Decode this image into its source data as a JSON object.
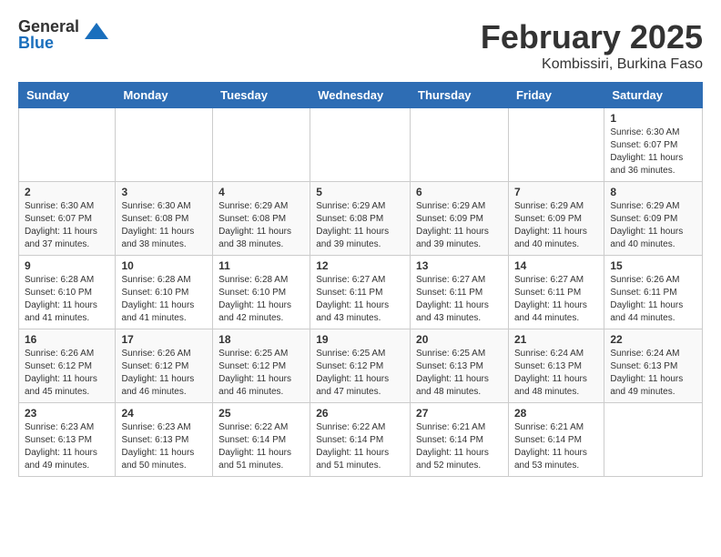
{
  "header": {
    "logo_general": "General",
    "logo_blue": "Blue",
    "month_title": "February 2025",
    "location": "Kombissiri, Burkina Faso"
  },
  "days_of_week": [
    "Sunday",
    "Monday",
    "Tuesday",
    "Wednesday",
    "Thursday",
    "Friday",
    "Saturday"
  ],
  "weeks": [
    [
      {
        "day": "",
        "info": ""
      },
      {
        "day": "",
        "info": ""
      },
      {
        "day": "",
        "info": ""
      },
      {
        "day": "",
        "info": ""
      },
      {
        "day": "",
        "info": ""
      },
      {
        "day": "",
        "info": ""
      },
      {
        "day": "1",
        "info": "Sunrise: 6:30 AM\nSunset: 6:07 PM\nDaylight: 11 hours and 36 minutes."
      }
    ],
    [
      {
        "day": "2",
        "info": "Sunrise: 6:30 AM\nSunset: 6:07 PM\nDaylight: 11 hours and 37 minutes."
      },
      {
        "day": "3",
        "info": "Sunrise: 6:30 AM\nSunset: 6:08 PM\nDaylight: 11 hours and 38 minutes."
      },
      {
        "day": "4",
        "info": "Sunrise: 6:29 AM\nSunset: 6:08 PM\nDaylight: 11 hours and 38 minutes."
      },
      {
        "day": "5",
        "info": "Sunrise: 6:29 AM\nSunset: 6:08 PM\nDaylight: 11 hours and 39 minutes."
      },
      {
        "day": "6",
        "info": "Sunrise: 6:29 AM\nSunset: 6:09 PM\nDaylight: 11 hours and 39 minutes."
      },
      {
        "day": "7",
        "info": "Sunrise: 6:29 AM\nSunset: 6:09 PM\nDaylight: 11 hours and 40 minutes."
      },
      {
        "day": "8",
        "info": "Sunrise: 6:29 AM\nSunset: 6:09 PM\nDaylight: 11 hours and 40 minutes."
      }
    ],
    [
      {
        "day": "9",
        "info": "Sunrise: 6:28 AM\nSunset: 6:10 PM\nDaylight: 11 hours and 41 minutes."
      },
      {
        "day": "10",
        "info": "Sunrise: 6:28 AM\nSunset: 6:10 PM\nDaylight: 11 hours and 41 minutes."
      },
      {
        "day": "11",
        "info": "Sunrise: 6:28 AM\nSunset: 6:10 PM\nDaylight: 11 hours and 42 minutes."
      },
      {
        "day": "12",
        "info": "Sunrise: 6:27 AM\nSunset: 6:11 PM\nDaylight: 11 hours and 43 minutes."
      },
      {
        "day": "13",
        "info": "Sunrise: 6:27 AM\nSunset: 6:11 PM\nDaylight: 11 hours and 43 minutes."
      },
      {
        "day": "14",
        "info": "Sunrise: 6:27 AM\nSunset: 6:11 PM\nDaylight: 11 hours and 44 minutes."
      },
      {
        "day": "15",
        "info": "Sunrise: 6:26 AM\nSunset: 6:11 PM\nDaylight: 11 hours and 44 minutes."
      }
    ],
    [
      {
        "day": "16",
        "info": "Sunrise: 6:26 AM\nSunset: 6:12 PM\nDaylight: 11 hours and 45 minutes."
      },
      {
        "day": "17",
        "info": "Sunrise: 6:26 AM\nSunset: 6:12 PM\nDaylight: 11 hours and 46 minutes."
      },
      {
        "day": "18",
        "info": "Sunrise: 6:25 AM\nSunset: 6:12 PM\nDaylight: 11 hours and 46 minutes."
      },
      {
        "day": "19",
        "info": "Sunrise: 6:25 AM\nSunset: 6:12 PM\nDaylight: 11 hours and 47 minutes."
      },
      {
        "day": "20",
        "info": "Sunrise: 6:25 AM\nSunset: 6:13 PM\nDaylight: 11 hours and 48 minutes."
      },
      {
        "day": "21",
        "info": "Sunrise: 6:24 AM\nSunset: 6:13 PM\nDaylight: 11 hours and 48 minutes."
      },
      {
        "day": "22",
        "info": "Sunrise: 6:24 AM\nSunset: 6:13 PM\nDaylight: 11 hours and 49 minutes."
      }
    ],
    [
      {
        "day": "23",
        "info": "Sunrise: 6:23 AM\nSunset: 6:13 PM\nDaylight: 11 hours and 49 minutes."
      },
      {
        "day": "24",
        "info": "Sunrise: 6:23 AM\nSunset: 6:13 PM\nDaylight: 11 hours and 50 minutes."
      },
      {
        "day": "25",
        "info": "Sunrise: 6:22 AM\nSunset: 6:14 PM\nDaylight: 11 hours and 51 minutes."
      },
      {
        "day": "26",
        "info": "Sunrise: 6:22 AM\nSunset: 6:14 PM\nDaylight: 11 hours and 51 minutes."
      },
      {
        "day": "27",
        "info": "Sunrise: 6:21 AM\nSunset: 6:14 PM\nDaylight: 11 hours and 52 minutes."
      },
      {
        "day": "28",
        "info": "Sunrise: 6:21 AM\nSunset: 6:14 PM\nDaylight: 11 hours and 53 minutes."
      },
      {
        "day": "",
        "info": ""
      }
    ]
  ]
}
